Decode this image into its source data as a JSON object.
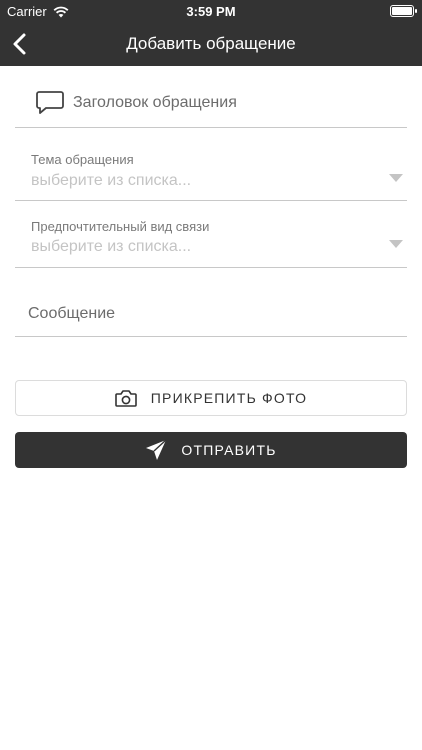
{
  "status_bar": {
    "carrier": "Carrier",
    "time": "3:59 PM"
  },
  "nav": {
    "title": "Добавить обращение"
  },
  "form": {
    "subject_placeholder": "Заголовок обращения",
    "topic": {
      "label": "Тема обращения",
      "placeholder": "выберите из списка..."
    },
    "contact": {
      "label": "Предпочтительный вид связи",
      "placeholder": "выберите из списка..."
    },
    "message_placeholder": "Сообщение"
  },
  "buttons": {
    "attach_photo": "ПРИКРЕПИТЬ ФОТО",
    "send": "ОТПРАВИТЬ"
  },
  "colors": {
    "header_bg": "#333333",
    "send_bg": "#333333",
    "placeholder": "#c4c4c4",
    "divider": "#c8c8c8"
  }
}
